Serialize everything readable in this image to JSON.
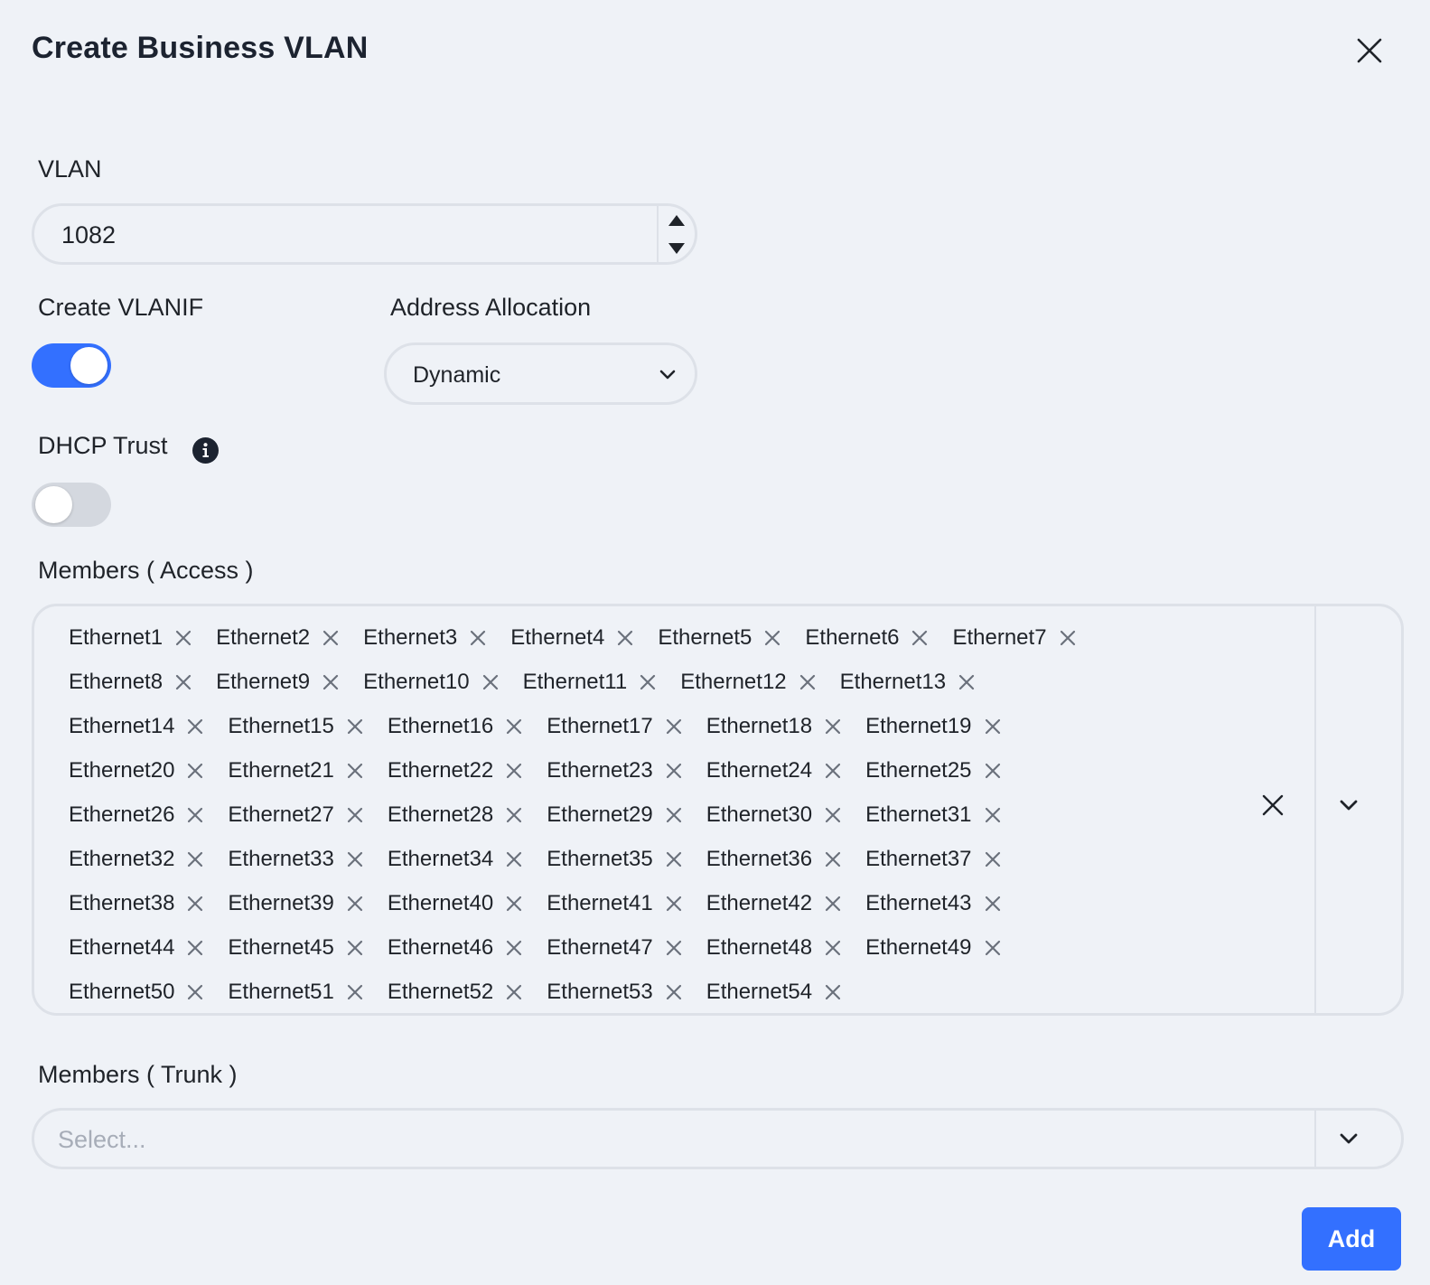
{
  "dialog": {
    "title": "Create Business VLAN"
  },
  "vlan": {
    "label": "VLAN",
    "value": "1082"
  },
  "vlanif": {
    "label": "Create VLANIF",
    "enabled": true
  },
  "address_allocation": {
    "label": "Address Allocation",
    "value": "Dynamic"
  },
  "dhcp_trust": {
    "label": "DHCP Trust",
    "enabled": false
  },
  "members_access": {
    "label": "Members ( Access )",
    "rows": [
      [
        "Ethernet1",
        "Ethernet2",
        "Ethernet3",
        "Ethernet4",
        "Ethernet5",
        "Ethernet6",
        "Ethernet7"
      ],
      [
        "Ethernet8",
        "Ethernet9",
        "Ethernet10",
        "Ethernet11",
        "Ethernet12",
        "Ethernet13"
      ],
      [
        "Ethernet14",
        "Ethernet15",
        "Ethernet16",
        "Ethernet17",
        "Ethernet18",
        "Ethernet19"
      ],
      [
        "Ethernet20",
        "Ethernet21",
        "Ethernet22",
        "Ethernet23",
        "Ethernet24",
        "Ethernet25"
      ],
      [
        "Ethernet26",
        "Ethernet27",
        "Ethernet28",
        "Ethernet29",
        "Ethernet30",
        "Ethernet31"
      ],
      [
        "Ethernet32",
        "Ethernet33",
        "Ethernet34",
        "Ethernet35",
        "Ethernet36",
        "Ethernet37"
      ],
      [
        "Ethernet38",
        "Ethernet39",
        "Ethernet40",
        "Ethernet41",
        "Ethernet42",
        "Ethernet43"
      ],
      [
        "Ethernet44",
        "Ethernet45",
        "Ethernet46",
        "Ethernet47",
        "Ethernet48",
        "Ethernet49"
      ],
      [
        "Ethernet50",
        "Ethernet51",
        "Ethernet52",
        "Ethernet53",
        "Ethernet54"
      ]
    ]
  },
  "members_trunk": {
    "label": "Members ( Trunk )",
    "placeholder": "Select..."
  },
  "actions": {
    "add_label": "Add"
  },
  "colors": {
    "accent": "#3370ff",
    "background": "#eff2f7",
    "border": "#dde1e8"
  },
  "icons": {
    "close": "close-icon",
    "tag_remove": "tag-remove-icon",
    "chevron": "chevron-down-icon",
    "info": "info-icon"
  }
}
